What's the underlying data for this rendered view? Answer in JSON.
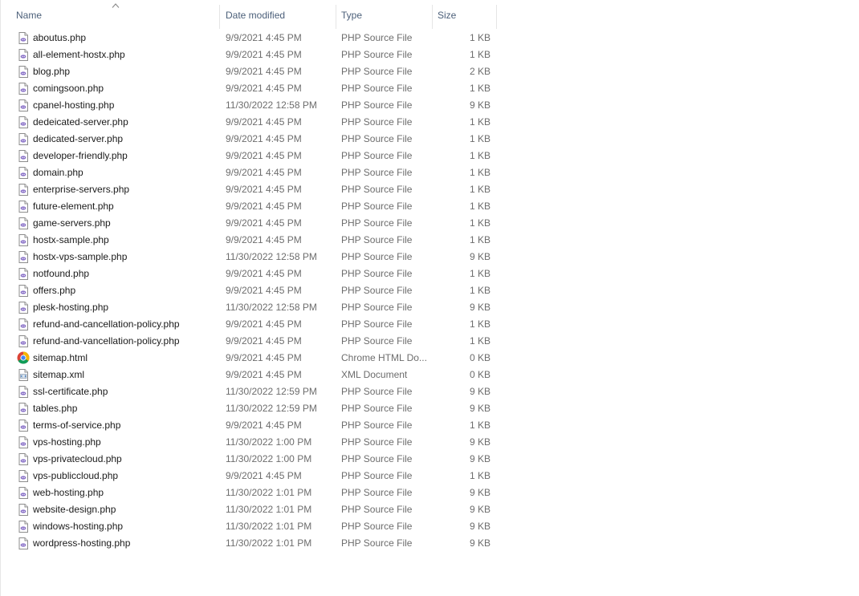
{
  "columns": {
    "name": "Name",
    "date": "Date modified",
    "type": "Type",
    "size": "Size"
  },
  "sort": {
    "column": "name",
    "direction": "ascending",
    "indicator_icon": "sort-up-icon"
  },
  "colors": {
    "php_icon_accent": "#8a72c8",
    "header_text": "#4c607a",
    "secondary_text": "#6d6d6d",
    "column_divider": "#e5e5e5"
  },
  "files": [
    {
      "name": "aboutus.php",
      "date": "9/9/2021 4:45 PM",
      "type": "PHP Source File",
      "size": "1 KB",
      "icon": "php-file-icon"
    },
    {
      "name": "all-element-hostx.php",
      "date": "9/9/2021 4:45 PM",
      "type": "PHP Source File",
      "size": "1 KB",
      "icon": "php-file-icon"
    },
    {
      "name": "blog.php",
      "date": "9/9/2021 4:45 PM",
      "type": "PHP Source File",
      "size": "2 KB",
      "icon": "php-file-icon"
    },
    {
      "name": "comingsoon.php",
      "date": "9/9/2021 4:45 PM",
      "type": "PHP Source File",
      "size": "1 KB",
      "icon": "php-file-icon"
    },
    {
      "name": "cpanel-hosting.php",
      "date": "11/30/2022 12:58 PM",
      "type": "PHP Source File",
      "size": "9 KB",
      "icon": "php-file-icon"
    },
    {
      "name": "dedeicated-server.php",
      "date": "9/9/2021 4:45 PM",
      "type": "PHP Source File",
      "size": "1 KB",
      "icon": "php-file-icon"
    },
    {
      "name": "dedicated-server.php",
      "date": "9/9/2021 4:45 PM",
      "type": "PHP Source File",
      "size": "1 KB",
      "icon": "php-file-icon"
    },
    {
      "name": "developer-friendly.php",
      "date": "9/9/2021 4:45 PM",
      "type": "PHP Source File",
      "size": "1 KB",
      "icon": "php-file-icon"
    },
    {
      "name": "domain.php",
      "date": "9/9/2021 4:45 PM",
      "type": "PHP Source File",
      "size": "1 KB",
      "icon": "php-file-icon"
    },
    {
      "name": "enterprise-servers.php",
      "date": "9/9/2021 4:45 PM",
      "type": "PHP Source File",
      "size": "1 KB",
      "icon": "php-file-icon"
    },
    {
      "name": "future-element.php",
      "date": "9/9/2021 4:45 PM",
      "type": "PHP Source File",
      "size": "1 KB",
      "icon": "php-file-icon"
    },
    {
      "name": "game-servers.php",
      "date": "9/9/2021 4:45 PM",
      "type": "PHP Source File",
      "size": "1 KB",
      "icon": "php-file-icon"
    },
    {
      "name": "hostx-sample.php",
      "date": "9/9/2021 4:45 PM",
      "type": "PHP Source File",
      "size": "1 KB",
      "icon": "php-file-icon"
    },
    {
      "name": "hostx-vps-sample.php",
      "date": "11/30/2022 12:58 PM",
      "type": "PHP Source File",
      "size": "9 KB",
      "icon": "php-file-icon"
    },
    {
      "name": "notfound.php",
      "date": "9/9/2021 4:45 PM",
      "type": "PHP Source File",
      "size": "1 KB",
      "icon": "php-file-icon"
    },
    {
      "name": "offers.php",
      "date": "9/9/2021 4:45 PM",
      "type": "PHP Source File",
      "size": "1 KB",
      "icon": "php-file-icon"
    },
    {
      "name": "plesk-hosting.php",
      "date": "11/30/2022 12:58 PM",
      "type": "PHP Source File",
      "size": "9 KB",
      "icon": "php-file-icon"
    },
    {
      "name": "refund-and-cancellation-policy.php",
      "date": "9/9/2021 4:45 PM",
      "type": "PHP Source File",
      "size": "1 KB",
      "icon": "php-file-icon"
    },
    {
      "name": "refund-and-vancellation-policy.php",
      "date": "9/9/2021 4:45 PM",
      "type": "PHP Source File",
      "size": "1 KB",
      "icon": "php-file-icon"
    },
    {
      "name": "sitemap.html",
      "date": "9/9/2021 4:45 PM",
      "type": "Chrome HTML Do...",
      "size": "0 KB",
      "icon": "chrome-icon"
    },
    {
      "name": "sitemap.xml",
      "date": "9/9/2021 4:45 PM",
      "type": "XML Document",
      "size": "0 KB",
      "icon": "xml-file-icon"
    },
    {
      "name": "ssl-certificate.php",
      "date": "11/30/2022 12:59 PM",
      "type": "PHP Source File",
      "size": "9 KB",
      "icon": "php-file-icon"
    },
    {
      "name": "tables.php",
      "date": "11/30/2022 12:59 PM",
      "type": "PHP Source File",
      "size": "9 KB",
      "icon": "php-file-icon"
    },
    {
      "name": "terms-of-service.php",
      "date": "9/9/2021 4:45 PM",
      "type": "PHP Source File",
      "size": "1 KB",
      "icon": "php-file-icon"
    },
    {
      "name": "vps-hosting.php",
      "date": "11/30/2022 1:00 PM",
      "type": "PHP Source File",
      "size": "9 KB",
      "icon": "php-file-icon"
    },
    {
      "name": "vps-privatecloud.php",
      "date": "11/30/2022 1:00 PM",
      "type": "PHP Source File",
      "size": "9 KB",
      "icon": "php-file-icon"
    },
    {
      "name": "vps-publiccloud.php",
      "date": "9/9/2021 4:45 PM",
      "type": "PHP Source File",
      "size": "1 KB",
      "icon": "php-file-icon"
    },
    {
      "name": "web-hosting.php",
      "date": "11/30/2022 1:01 PM",
      "type": "PHP Source File",
      "size": "9 KB",
      "icon": "php-file-icon"
    },
    {
      "name": "website-design.php",
      "date": "11/30/2022 1:01 PM",
      "type": "PHP Source File",
      "size": "9 KB",
      "icon": "php-file-icon"
    },
    {
      "name": "windows-hosting.php",
      "date": "11/30/2022 1:01 PM",
      "type": "PHP Source File",
      "size": "9 KB",
      "icon": "php-file-icon"
    },
    {
      "name": "wordpress-hosting.php",
      "date": "11/30/2022 1:01 PM",
      "type": "PHP Source File",
      "size": "9 KB",
      "icon": "php-file-icon"
    }
  ]
}
